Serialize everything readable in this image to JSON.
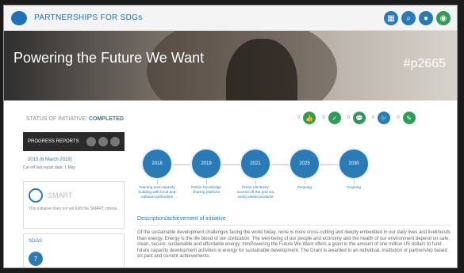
{
  "brand": {
    "title": "PARTNERSHIPS FOR SDGs",
    "colors": {
      "primary": "#1d72b8",
      "accent": "#2a7ab5",
      "dark": "#2b2b2b",
      "green": "#2f9c58"
    }
  },
  "top_icons": [
    {
      "name": "grid-icon",
      "glyph": "▦",
      "color": "#2a7ab5"
    },
    {
      "name": "search-icon",
      "glyph": "⌕",
      "color": "#2a7ab5"
    },
    {
      "name": "drop-icon",
      "glyph": "●",
      "color": "#2a7ab5"
    },
    {
      "name": "profile-icon",
      "glyph": "◉",
      "color": "#2f9c58"
    }
  ],
  "hero": {
    "title": "Powering the Future We Want",
    "tag": "#p2665"
  },
  "status": {
    "label": "STATUS OF INITIATIVE:",
    "value": "COMPLETED"
  },
  "summary": [
    {
      "count": "0",
      "glyph": "👍",
      "color": "#2f9c58",
      "name": "like-icon"
    },
    {
      "count": "0",
      "glyph": "✓",
      "color": "#2f9c58",
      "name": "check-icon"
    },
    {
      "count": "0",
      "glyph": "💬",
      "color": "#2f9c58",
      "name": "comment-icon"
    },
    {
      "count": "0",
      "glyph": "🐦",
      "color": "#2a7ab5",
      "name": "twitter-icon"
    },
    {
      "count": "0",
      "glyph": "✎",
      "color": "#2f9c58",
      "name": "edit-icon"
    }
  ],
  "sidebar": {
    "progress_title": "PROGRESS REPORTS",
    "report_link": "2015 (6 March 2018)",
    "report_note": "Cut-off last report date: 1 May",
    "smart_label": "SMART",
    "smart_note": "This initiative does not yet fulfil the SMART criteria.",
    "sdgs_title": "SDGS",
    "sdg_badge": "7"
  },
  "timeline": [
    {
      "year": "2018",
      "label": "Training and capacity building with local and national authorities"
    },
    {
      "year": "2019",
      "label": "Online knowledge sharing platform"
    },
    {
      "year": "2021",
      "label": "Direct electricity access off the grid via using waste products"
    },
    {
      "year": "2025",
      "label": "Ongoing"
    },
    {
      "year": "2030",
      "label": "Ongoing"
    }
  ],
  "description": {
    "title": "Description/achievement of initiative",
    "text": "Of the sustainable development challenges facing the world today, none is more cross-cutting and deeply embedded in our daily lives and livelihoods than energy. Energy is the life blood of our civilization. The well-being of our people and economy and the health of our environment depend on safe, clean, secure, sustainable and affordable energy. mmPowering the Future We Want offers a grant in the amount of one million US dollars to fund future capacity development activities in energy for sustainable development. The Grant is awarded to an individual, institution or partnership based on past and current achievements."
  }
}
